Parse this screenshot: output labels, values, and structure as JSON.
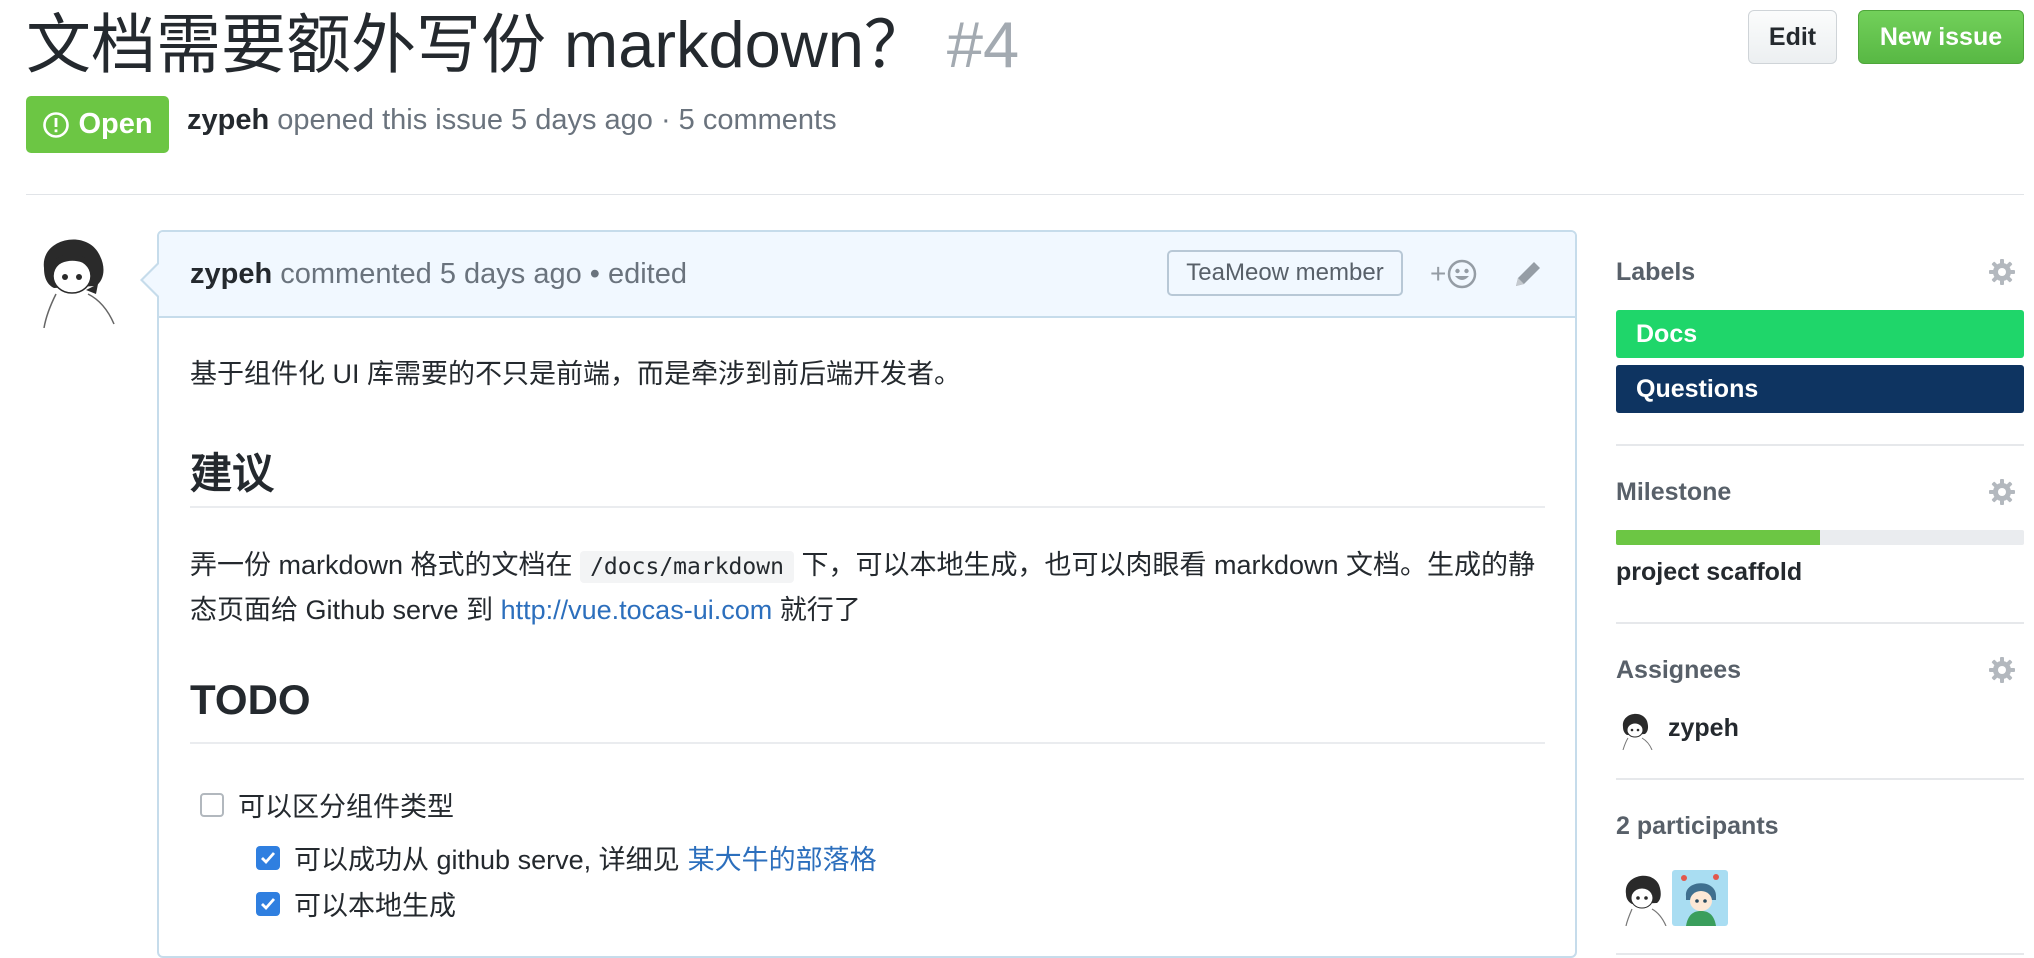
{
  "issue": {
    "title": "文档需要额外写份 markdown？",
    "number": "#4",
    "state": "Open",
    "author": "zypeh",
    "meta_text": "opened this issue 5 days ago · 5 comments"
  },
  "header_buttons": {
    "edit": "Edit",
    "new_issue": "New issue"
  },
  "comment": {
    "author": "zypeh",
    "meta": "commented 5 days ago • edited",
    "badge": "TeaMeow member",
    "react_plus": "+",
    "p1": "基于组件化 UI 库需要的不只是前端，而是牵涉到前后端开发者。",
    "h_suggest": "建议",
    "p2_before": "弄一份 markdown 格式的文档在",
    "p2_code": "/docs/markdown",
    "p2_middle": "下，可以本地生成，也可以肉眼看 markdown 文档。生成的静态页面给 Github serve 到",
    "p2_link": "http://vue.tocas-ui.com",
    "p2_after": "就行了",
    "h_todo": "TODO",
    "tasks": [
      {
        "text": "可以区分组件类型",
        "checked": false
      },
      {
        "text": "可以成功从 github serve, 详细见",
        "link": "某大牛的部落格",
        "checked": true
      },
      {
        "text": "可以本地生成",
        "checked": true
      }
    ]
  },
  "sidebar": {
    "labels_heading": "Labels",
    "labels": [
      {
        "name": "Docs",
        "color": "#1fd66a"
      },
      {
        "name": "Questions",
        "color": "#0e3461"
      }
    ],
    "milestone_heading": "Milestone",
    "milestone_progress": 0.5,
    "milestone_title": "project scaffold",
    "assignees_heading": "Assignees",
    "assignee": "zypeh",
    "participants_heading": "2 participants"
  },
  "colors": {
    "open_green": "#6cc644",
    "new_issue_green": "#5cbf47",
    "link_blue": "#2c6fbd",
    "comment_border": "#c6dceb",
    "comment_header_bg": "#f1f8ff"
  }
}
